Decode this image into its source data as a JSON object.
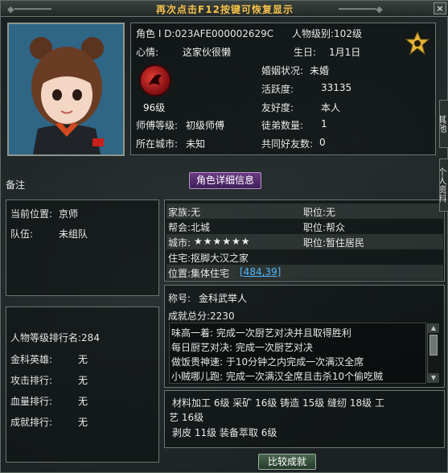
{
  "window": {
    "title": "再次点击F12按键可恢复显示",
    "close_label": "×"
  },
  "profile": {
    "role_id": "角色 I D:023AFE000002629C",
    "level_label": "人物级别:102级",
    "mood_label": "心情:",
    "mood_value": "这家伙很懒",
    "birthday_label": "生日:",
    "birthday_value": "1月1日",
    "marriage_label": "婚姻状况:",
    "marriage_value": "未婚",
    "activity_label": "活跃度:",
    "activity_value": "33135",
    "friendship_label": "友好度:",
    "friendship_value": "本人",
    "emblem_level": "96级",
    "master_label": "师傅等级:",
    "master_value": "初级师傅",
    "apprentice_label": "徒弟数量:",
    "apprentice_value": "1",
    "city_label": "所在城市:",
    "city_value": "未知",
    "common_friends_label": "共同好友数:",
    "common_friends_value": "0"
  },
  "remark_label": "备注",
  "detail_button": "角色详细信息",
  "location": {
    "position_label": "当前位置:",
    "position_value": "京师",
    "team_label": "队伍:",
    "team_value": "未组队"
  },
  "family": {
    "family_label": "家族:无",
    "family_post": "职位:无",
    "guild_label": "帮会:北城",
    "guild_post": "职位:帮众",
    "city_label": "城市:",
    "city_stars": "★★★★★★",
    "city_post": "职位:暂住居民",
    "residence": "住宅:抠脚大汉之家",
    "position_prefix": "位置:集体住宅",
    "position_link": "[484,39]"
  },
  "ranking": {
    "title_rank": "人物等级排行名:284",
    "rows": [
      {
        "label": "金科英雄:",
        "value": "无"
      },
      {
        "label": "攻击排行:",
        "value": "无"
      },
      {
        "label": "血量排行:",
        "value": "无"
      },
      {
        "label": "成就排行:",
        "value": "无"
      }
    ]
  },
  "achievement": {
    "title_label": "称号:",
    "title_value": "金科武举人",
    "score": "成就总分:2230",
    "list": [
      "味高一着: 完成一次厨艺对决并且取得胜利",
      "每日厨艺对决: 完成一次厨艺对决",
      "做饭贵神速: 于10分钟之内完成一次满汉全席",
      "小贼哪儿跑: 完成一次满汉全席且击杀10个偷吃贼"
    ]
  },
  "skills": {
    "line1": "材料加工 6级  采矿 16级  铸造 15级  缝纫 18级  工",
    "line2": "艺 16级",
    "line3": "剥皮 11级  装备萃取 6级"
  },
  "compare_button": "比较成就",
  "side_tabs": [
    "其他",
    "个人资料"
  ],
  "colors": {
    "title": "#f4c04a",
    "link": "#4fb7ff",
    "button_purple": "#6b3b84"
  },
  "icons": [
    "close-icon",
    "guild-emblem-icon",
    "badge-icon",
    "scroll-up-icon",
    "scroll-down-icon"
  ]
}
